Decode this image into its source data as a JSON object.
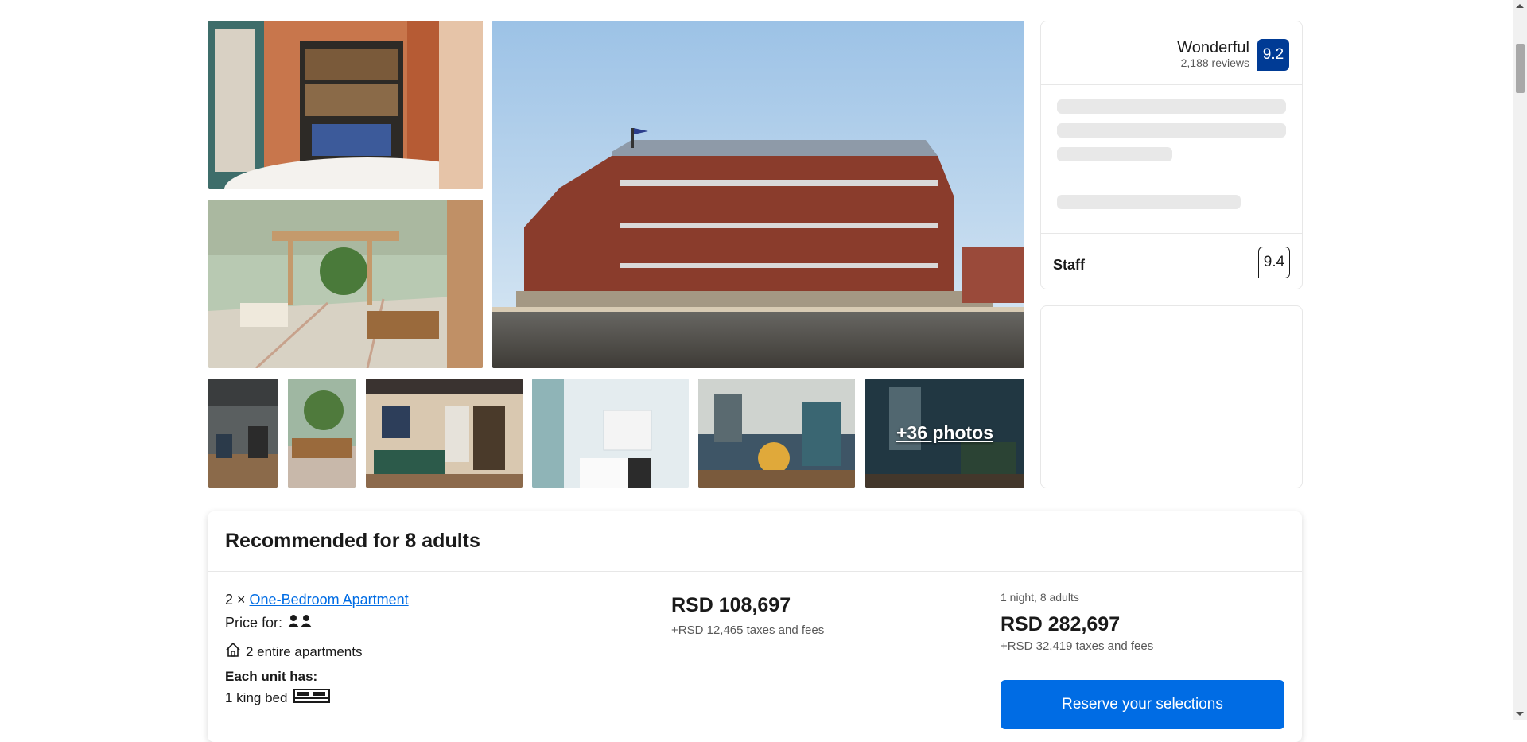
{
  "gallery": {
    "more_photos_label": "+36 photos"
  },
  "reviews": {
    "rating_word": "Wonderful",
    "review_count": "2,188 reviews",
    "score": "9.2",
    "category_label": "Staff",
    "category_score": "9.4"
  },
  "recommended": {
    "title": "Recommended for 8 adults",
    "room_qty": "2 ×",
    "room_name": "One-Bedroom Apartment",
    "price_for_label": "Price for:",
    "units_text": "2 entire apartments",
    "each_unit_label": "Each unit has:",
    "bed_text": "1 king bed",
    "unit_price": "RSD 108,697",
    "unit_taxes": "+RSD 12,465 taxes and fees",
    "stay_summary": "1 night, 8 adults",
    "total_price": "RSD 282,697",
    "total_taxes": "+RSD 32,419 taxes and fees",
    "reserve_label": "Reserve your selections"
  },
  "icons": {
    "persons": "person-icon",
    "home": "home-icon",
    "bed": "bed-icon"
  },
  "colors": {
    "brand_blue": "#003b95",
    "action_blue": "#006ce4"
  }
}
